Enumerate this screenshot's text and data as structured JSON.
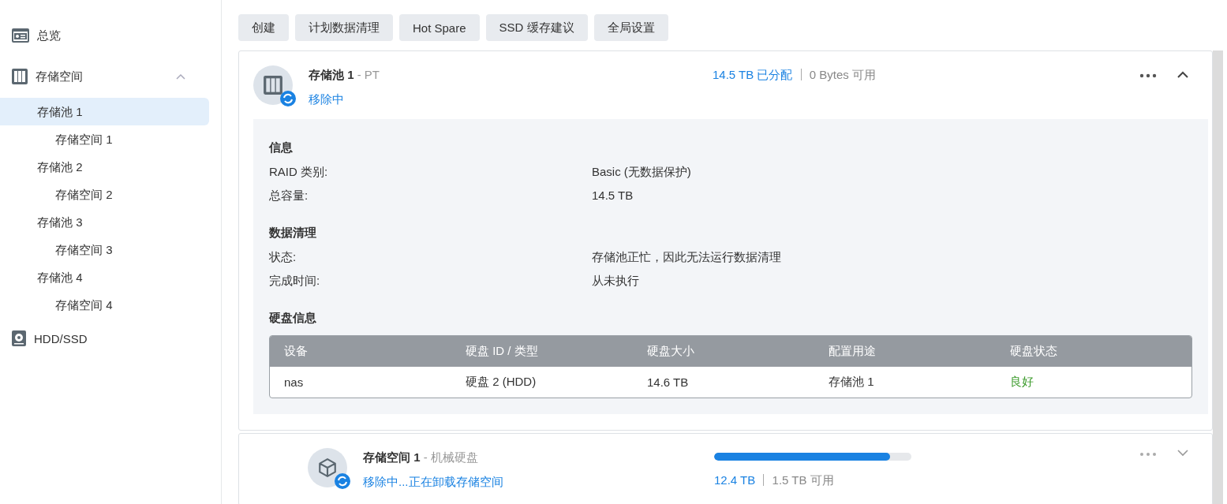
{
  "sidebar": {
    "items": [
      {
        "kind": "overview",
        "label": "总览",
        "selected": false
      },
      {
        "kind": "storage",
        "label": "存储空间",
        "selected": false,
        "expanded": true,
        "children": [
          {
            "label": "存储池 1",
            "selected": true,
            "children": [
              {
                "label": "存储空间 1",
                "selected": false
              }
            ]
          },
          {
            "label": "存储池 2",
            "selected": false,
            "children": [
              {
                "label": "存储空间 2",
                "selected": false
              }
            ]
          },
          {
            "label": "存储池 3",
            "selected": false,
            "children": [
              {
                "label": "存储空间 3",
                "selected": false
              }
            ]
          },
          {
            "label": "存储池 4",
            "selected": false,
            "children": [
              {
                "label": "存储空间 4",
                "selected": false
              }
            ]
          }
        ]
      },
      {
        "kind": "disk",
        "label": "HDD/SSD",
        "selected": false
      }
    ]
  },
  "toolbar": [
    "创建",
    "计划数据清理",
    "Hot Spare",
    "SSD 缓存建议",
    "全局设置"
  ],
  "pool": {
    "name": "存储池 1",
    "note": "- PT",
    "status": "移除中",
    "allocated": "14.5 TB 已分配",
    "available": "0 Bytes 可用",
    "expanded": true,
    "sections": [
      {
        "title": "信息",
        "rows": [
          {
            "label": "RAID 类别:",
            "value": "Basic (无数据保护)"
          },
          {
            "label": "总容量:",
            "value": "14.5 TB"
          }
        ]
      },
      {
        "title": "数据清理",
        "rows": [
          {
            "label": "状态:",
            "value": "存储池正忙，因此无法运行数据清理"
          },
          {
            "label": "完成时间:",
            "value": "从未执行"
          }
        ]
      }
    ],
    "disks": {
      "title": "硬盘信息",
      "columns": [
        "设备",
        "硬盘 ID / 类型",
        "硬盘大小",
        "配置用途",
        "硬盘状态"
      ],
      "rows": [
        {
          "cells": [
            "nas",
            "硬盘 2 (HDD)",
            "14.6 TB",
            "存储池 1",
            "良好"
          ],
          "color": "#3a9a2a"
        }
      ]
    }
  },
  "volume": {
    "name": "存储空间 1",
    "note": "- 机械硬盘",
    "status": "移除中...正在卸载存储空间",
    "level": 0.89,
    "used": "12.4 TB",
    "available": "1.5 TB 可用",
    "expanded": false
  }
}
